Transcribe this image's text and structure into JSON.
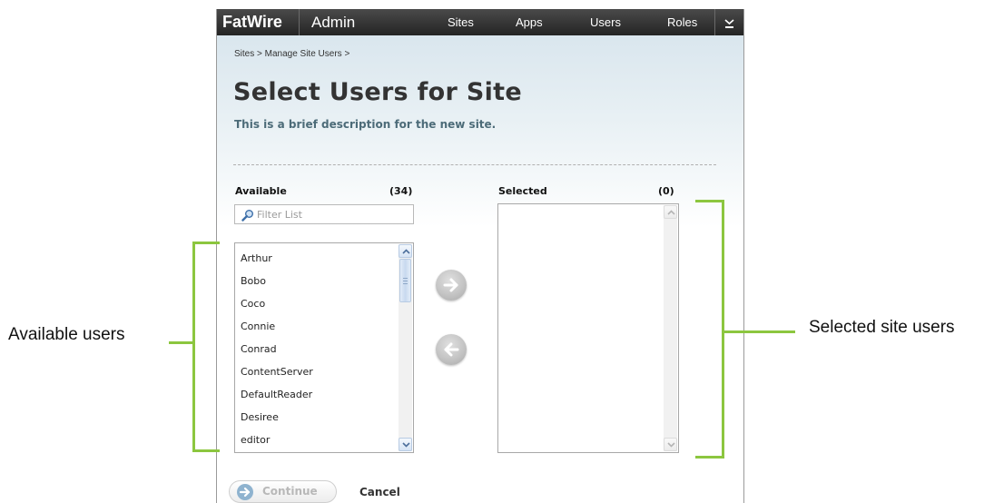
{
  "app": {
    "brand": "FatWire",
    "app_name": "Admin",
    "nav": [
      "Sites",
      "Apps",
      "Users",
      "Roles"
    ],
    "menu_icon": "chevron-down-icon"
  },
  "breadcrumb": "Sites > Manage Site Users >",
  "page": {
    "title": "Select Users for Site",
    "description": "This is a brief description for the new site."
  },
  "available": {
    "label": "Available",
    "count": "(34)",
    "filter_placeholder": "Filter List",
    "items": [
      "Arthur",
      "Bobo",
      "Coco",
      "Connie",
      "Conrad",
      "ContentServer",
      "DefaultReader",
      "Desiree",
      "editor"
    ]
  },
  "selected": {
    "label": "Selected",
    "count": "(0)",
    "items": []
  },
  "actions": {
    "add_icon": "arrow-right-icon",
    "remove_icon": "arrow-left-icon",
    "continue_label": "Continue",
    "cancel_label": "Cancel"
  },
  "annotations": {
    "left": "Available users",
    "right": "Selected site users"
  },
  "colors": {
    "accent": "#8cc63f",
    "topbar": "#2e2e2e",
    "description": "#4c6b78"
  }
}
